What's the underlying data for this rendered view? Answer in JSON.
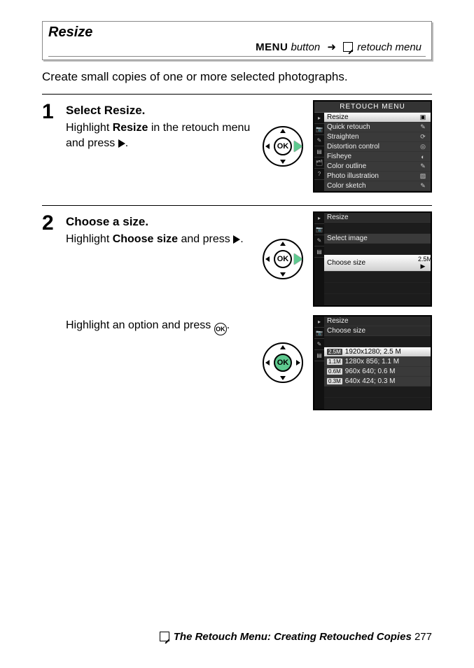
{
  "title_box": {
    "title": "Resize",
    "path": {
      "menu_label": "MENU",
      "button_word": " button",
      "arrow": "➜",
      "target": " retouch menu"
    }
  },
  "intro": "Create small copies of one or more selected photographs.",
  "steps": {
    "s1": {
      "num": "1",
      "title": "Select Resize.",
      "text_a": "Highlight ",
      "text_bold": "Resize",
      "text_b": " in the retouch menu and press ",
      "text_c": "."
    },
    "s2": {
      "num": "2",
      "title": "Choose a size.",
      "p1_a": "Highlight ",
      "p1_bold": "Choose size",
      "p1_b": " and press ",
      "p1_c": ".",
      "p2_a": "Highlight an option and press ",
      "p2_b": "."
    }
  },
  "screen1": {
    "header": "RETOUCH MENU",
    "rows": [
      {
        "label": "Resize",
        "icon": "▣",
        "sel": true
      },
      {
        "label": "Quick retouch",
        "icon": "✎"
      },
      {
        "label": "Straighten",
        "icon": "⟳"
      },
      {
        "label": "Distortion control",
        "icon": "◎"
      },
      {
        "label": "Fisheye",
        "icon": "◐"
      },
      {
        "label": "Color outline",
        "icon": "✎"
      },
      {
        "label": "Photo illustration",
        "icon": "▨"
      },
      {
        "label": "Color sketch",
        "icon": "✎"
      }
    ]
  },
  "screen2": {
    "subtitle": "Resize",
    "rows": {
      "select_image": "Select image",
      "choose_size": "Choose size",
      "choose_size_val": "2.5M ▶"
    }
  },
  "screen3": {
    "subtitle": "Resize",
    "subtitle2": "Choose size",
    "sizes": [
      {
        "badge": "2.5M",
        "label": "1920x1280; 2.5 M",
        "sel": true
      },
      {
        "badge": "1.1M",
        "label": "1280x  856; 1.1 M"
      },
      {
        "badge": "0.6M",
        "label": "  960x  640; 0.6 M"
      },
      {
        "badge": "0.3M",
        "label": "  640x  424; 0.3 M"
      }
    ]
  },
  "footer": {
    "section": "The Retouch Menu: Creating Retouched Copies",
    "page": "277"
  },
  "ok_label": "OK"
}
